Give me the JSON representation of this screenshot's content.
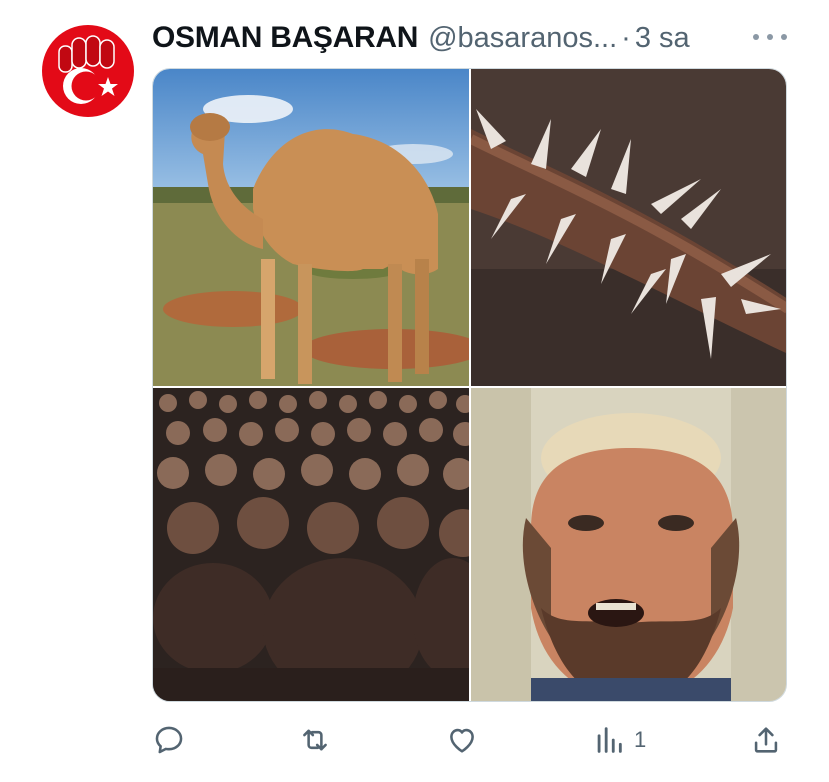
{
  "tweet": {
    "display_name": "OSMAN BAŞARAN",
    "handle": "@basaranos...",
    "separator": "·",
    "time": "3 sa"
  },
  "avatar": {
    "icon": "turkish-flag-fist-icon",
    "colors": {
      "bg": "#e30a17",
      "fg": "#ffffff"
    }
  },
  "media": {
    "images": [
      {
        "name": "camel-image",
        "description_icon": "camel"
      },
      {
        "name": "thorn-branch-image",
        "description_icon": "thorns"
      },
      {
        "name": "crowd-image",
        "description_icon": "crowd"
      },
      {
        "name": "bearded-man-image",
        "description_icon": "man"
      }
    ]
  },
  "actions": {
    "reply_icon": "reply-icon",
    "retweet_icon": "retweet-icon",
    "like_icon": "like-icon",
    "views_icon": "views-icon",
    "views_count": "1",
    "share_icon": "share-icon"
  },
  "colors": {
    "secondary_text": "#536471",
    "border": "#cfd9de"
  }
}
